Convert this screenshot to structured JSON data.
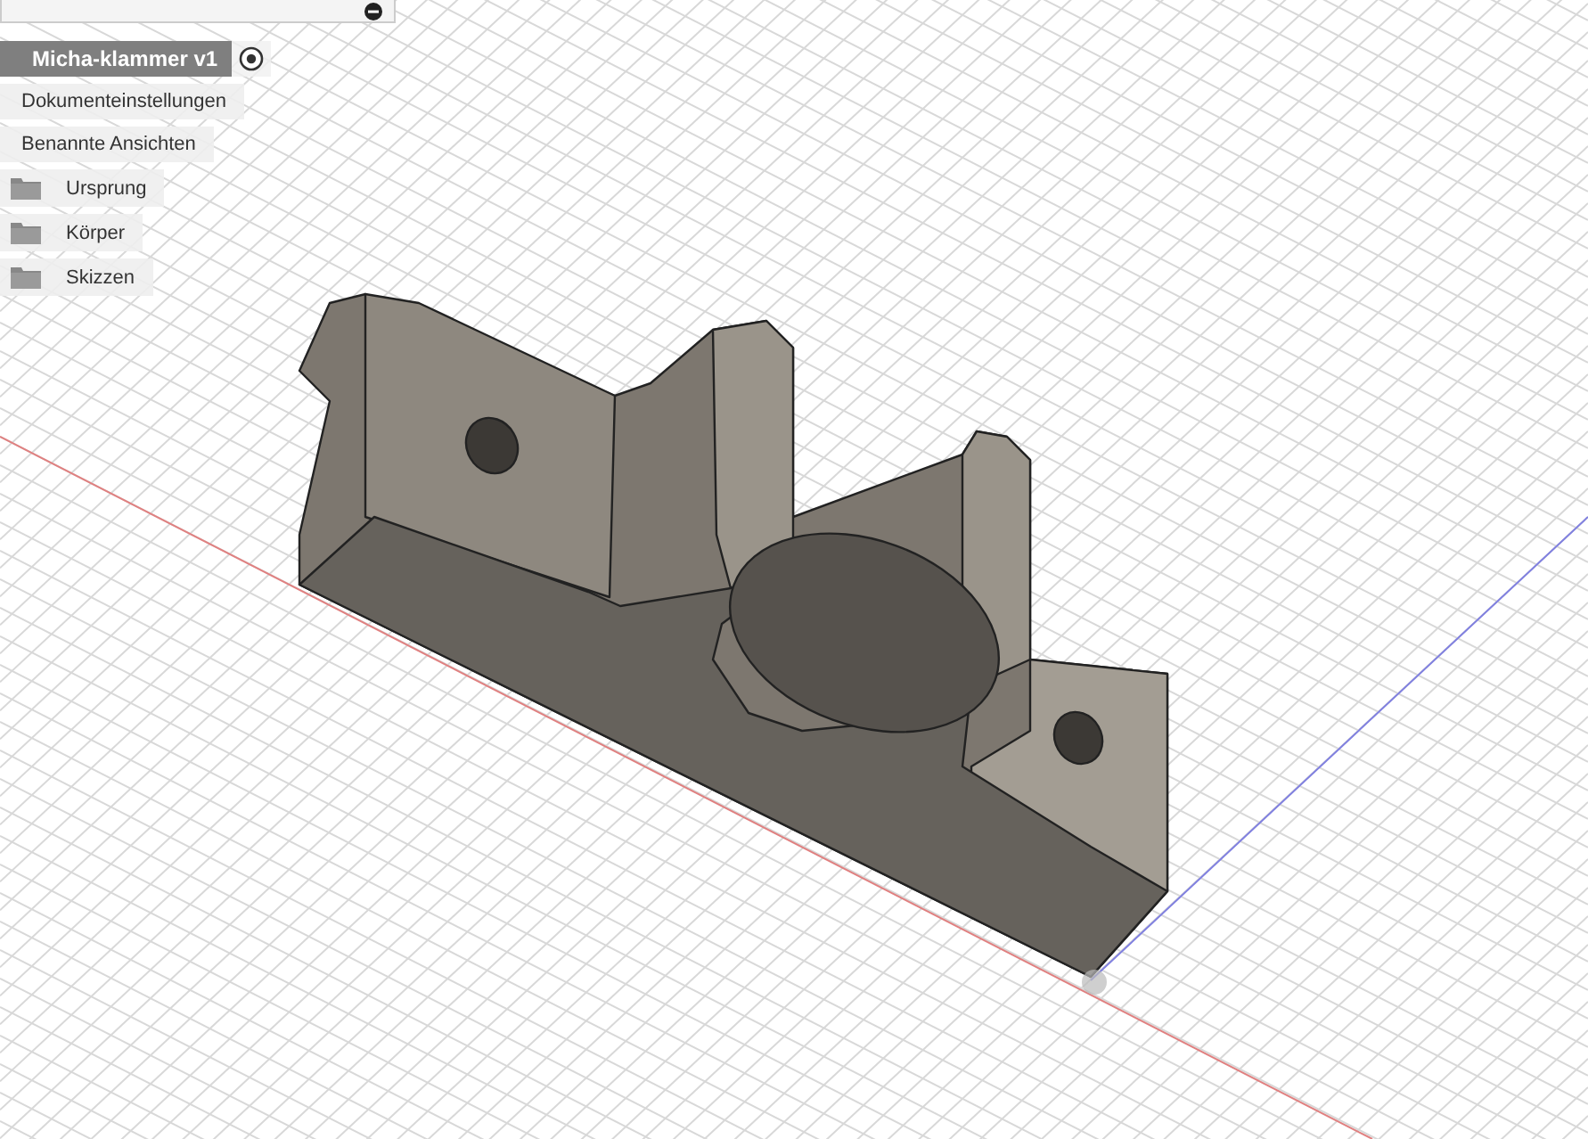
{
  "browser": {
    "component": {
      "name": "Micha-klammer v1",
      "active": true
    },
    "items": [
      {
        "label": "Dokumenteinstellungen",
        "kind": "setting"
      },
      {
        "label": "Benannte Ansichten",
        "kind": "setting"
      },
      {
        "label": "Ursprung",
        "kind": "folder"
      },
      {
        "label": "Körper",
        "kind": "folder"
      },
      {
        "label": "Skizzen",
        "kind": "folder"
      }
    ]
  }
}
